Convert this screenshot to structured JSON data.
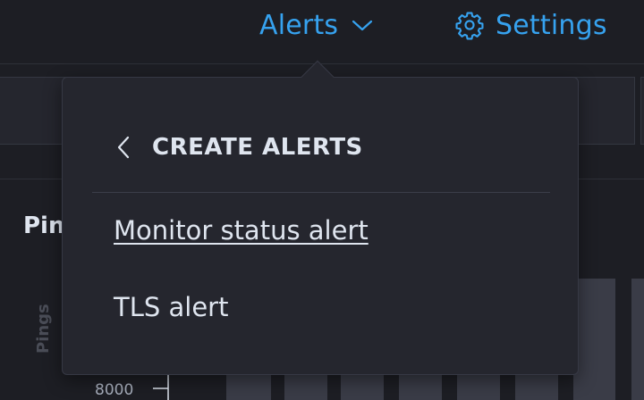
{
  "header": {
    "alerts_label": "Alerts",
    "settings_label": "Settings",
    "accent_color": "#36a2ef"
  },
  "panel": {
    "title_partial": "Pin",
    "y_axis_label": "Pings",
    "y_tick": "8000"
  },
  "popover": {
    "title": "CREATE ALERTS",
    "back_icon": "chevron-left-icon",
    "items": [
      {
        "label": "Monitor status alert"
      },
      {
        "label": "TLS alert"
      }
    ]
  },
  "icons": {
    "alerts_chevron": "chevron-down-icon",
    "settings": "gear-icon"
  }
}
